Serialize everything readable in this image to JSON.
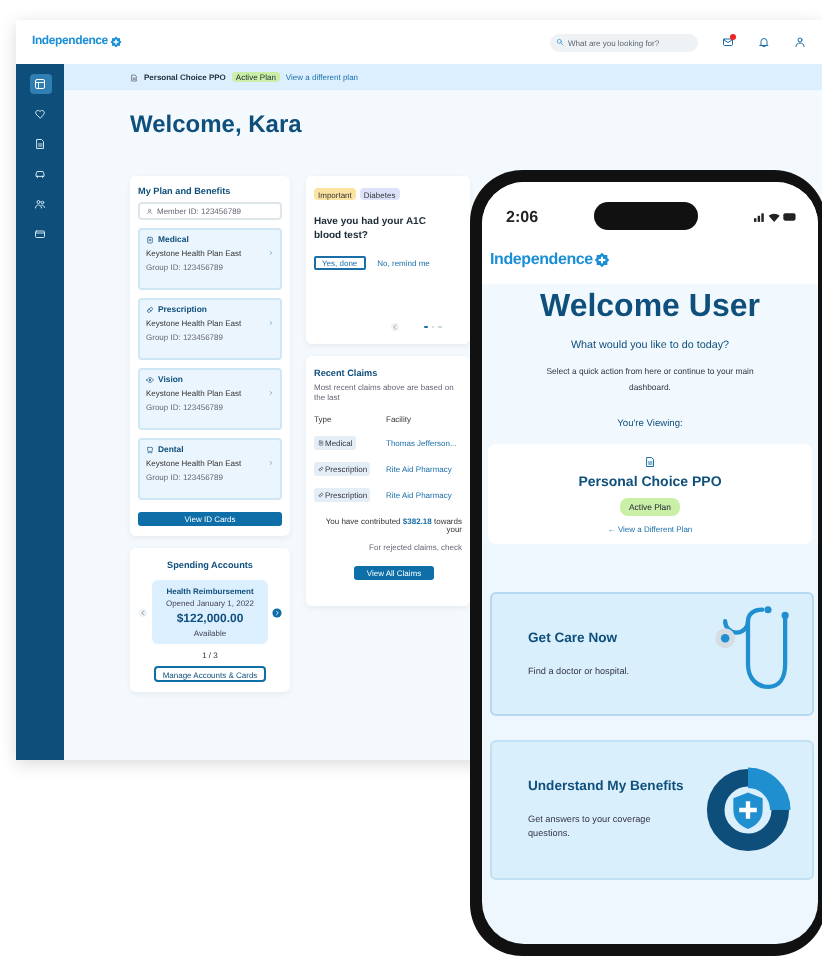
{
  "desktop": {
    "logo": "Independence",
    "search": {
      "placeholder": "What are you looking for?"
    },
    "header_icons": [
      {
        "kind": "mail",
        "badge": true
      },
      {
        "kind": "bell"
      },
      {
        "kind": "user"
      }
    ],
    "sidebar": [
      {
        "kind": "dashboard",
        "selected": true
      },
      {
        "kind": "care",
        "selected": false
      },
      {
        "kind": "claims",
        "selected": false
      },
      {
        "kind": "car",
        "selected": false
      },
      {
        "kind": "people",
        "selected": false
      },
      {
        "kind": "card",
        "selected": false
      }
    ],
    "plan_bar": {
      "name": "Personal Choice PPO",
      "status": "Active Plan",
      "link": "View a different plan"
    },
    "greeting": "Welcome, Kara",
    "plan_card": {
      "title": "My Plan and Benefits",
      "member_id": "Member ID: 123456789",
      "coverages": [
        {
          "kind": "medical",
          "name": "Medical",
          "plan": "Keystone Health Plan East",
          "group": "Group ID: 123456789"
        },
        {
          "kind": "prescription",
          "name": "Prescription",
          "plan": "Keystone Health Plan East",
          "group": "Group ID: 123456789"
        },
        {
          "kind": "vision",
          "name": "Vision",
          "plan": "Keystone Health Plan East",
          "group": "Group ID: 123456789"
        },
        {
          "kind": "dental",
          "name": "Dental",
          "plan": "Keystone Health Plan East",
          "group": "Group ID: 123456789"
        }
      ],
      "button": "View ID Cards"
    },
    "spending": {
      "title": "Spending Accounts",
      "account": "Health Reimbursement",
      "opened": "Opened January 1, 2022",
      "amount": "$122,000.00",
      "amount_label": "Available",
      "pager": "1 / 3",
      "button": "Manage Accounts & Cards"
    },
    "reminder": {
      "tags": [
        {
          "label": "Important",
          "color": "#fbe3a2"
        },
        {
          "label": "Diabetes",
          "color": "#dde2fa"
        }
      ],
      "question": "Have you had your A1C blood test?",
      "actions": [
        "Yes, done",
        "No, remind me"
      ],
      "dots": [
        {
          "selected": true
        },
        {
          "selected": false
        },
        {
          "selected": false
        }
      ]
    },
    "claims": {
      "title": "Recent Claims",
      "note": "Most recent claims above are based on the last",
      "columns": [
        "Type",
        "Facility"
      ],
      "rows": [
        {
          "kind": "medical",
          "type": "Medical",
          "facility": "Thomas Jefferson..."
        },
        {
          "kind": "prescription",
          "type": "Prescription",
          "facility": "Rite Aid Pharmacy"
        },
        {
          "kind": "prescription",
          "type": "Prescription",
          "facility": "Rite Aid Pharmacy"
        }
      ],
      "contribution": {
        "text": "You have contributed",
        "amount": "$382.18",
        "rest": "towards your"
      },
      "rejected": "For rejected claims, check",
      "button": "View All Claims"
    }
  },
  "phone": {
    "time": "2:06",
    "logo": "Independence",
    "title": "Welcome User",
    "question": "What would you like to do today?",
    "description": "Select a quick action from here or continue to your main dashboard.",
    "viewing": "You're Viewing:",
    "plan": {
      "name": "Personal Choice PPO",
      "status": "Active Plan",
      "link": "← View a Different Plan"
    },
    "actions": [
      {
        "kind": "care",
        "title": "Get Care Now",
        "text": "Find a doctor or hospital."
      },
      {
        "kind": "benefits",
        "title": "Understand My Benefits",
        "text": "Get answers to your coverage questions."
      }
    ]
  }
}
